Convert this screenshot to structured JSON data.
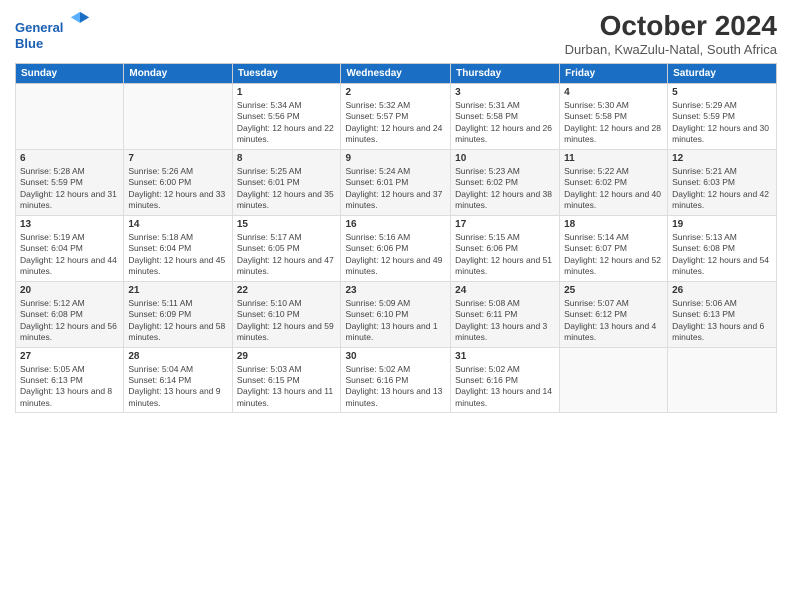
{
  "header": {
    "logo_line1": "General",
    "logo_line2": "Blue",
    "month": "October 2024",
    "location": "Durban, KwaZulu-Natal, South Africa"
  },
  "days_of_week": [
    "Sunday",
    "Monday",
    "Tuesday",
    "Wednesday",
    "Thursday",
    "Friday",
    "Saturday"
  ],
  "weeks": [
    [
      {
        "day": "",
        "info": ""
      },
      {
        "day": "",
        "info": ""
      },
      {
        "day": "1",
        "info": "Sunrise: 5:34 AM\nSunset: 5:56 PM\nDaylight: 12 hours and 22 minutes."
      },
      {
        "day": "2",
        "info": "Sunrise: 5:32 AM\nSunset: 5:57 PM\nDaylight: 12 hours and 24 minutes."
      },
      {
        "day": "3",
        "info": "Sunrise: 5:31 AM\nSunset: 5:58 PM\nDaylight: 12 hours and 26 minutes."
      },
      {
        "day": "4",
        "info": "Sunrise: 5:30 AM\nSunset: 5:58 PM\nDaylight: 12 hours and 28 minutes."
      },
      {
        "day": "5",
        "info": "Sunrise: 5:29 AM\nSunset: 5:59 PM\nDaylight: 12 hours and 30 minutes."
      }
    ],
    [
      {
        "day": "6",
        "info": "Sunrise: 5:28 AM\nSunset: 5:59 PM\nDaylight: 12 hours and 31 minutes."
      },
      {
        "day": "7",
        "info": "Sunrise: 5:26 AM\nSunset: 6:00 PM\nDaylight: 12 hours and 33 minutes."
      },
      {
        "day": "8",
        "info": "Sunrise: 5:25 AM\nSunset: 6:01 PM\nDaylight: 12 hours and 35 minutes."
      },
      {
        "day": "9",
        "info": "Sunrise: 5:24 AM\nSunset: 6:01 PM\nDaylight: 12 hours and 37 minutes."
      },
      {
        "day": "10",
        "info": "Sunrise: 5:23 AM\nSunset: 6:02 PM\nDaylight: 12 hours and 38 minutes."
      },
      {
        "day": "11",
        "info": "Sunrise: 5:22 AM\nSunset: 6:02 PM\nDaylight: 12 hours and 40 minutes."
      },
      {
        "day": "12",
        "info": "Sunrise: 5:21 AM\nSunset: 6:03 PM\nDaylight: 12 hours and 42 minutes."
      }
    ],
    [
      {
        "day": "13",
        "info": "Sunrise: 5:19 AM\nSunset: 6:04 PM\nDaylight: 12 hours and 44 minutes."
      },
      {
        "day": "14",
        "info": "Sunrise: 5:18 AM\nSunset: 6:04 PM\nDaylight: 12 hours and 45 minutes."
      },
      {
        "day": "15",
        "info": "Sunrise: 5:17 AM\nSunset: 6:05 PM\nDaylight: 12 hours and 47 minutes."
      },
      {
        "day": "16",
        "info": "Sunrise: 5:16 AM\nSunset: 6:06 PM\nDaylight: 12 hours and 49 minutes."
      },
      {
        "day": "17",
        "info": "Sunrise: 5:15 AM\nSunset: 6:06 PM\nDaylight: 12 hours and 51 minutes."
      },
      {
        "day": "18",
        "info": "Sunrise: 5:14 AM\nSunset: 6:07 PM\nDaylight: 12 hours and 52 minutes."
      },
      {
        "day": "19",
        "info": "Sunrise: 5:13 AM\nSunset: 6:08 PM\nDaylight: 12 hours and 54 minutes."
      }
    ],
    [
      {
        "day": "20",
        "info": "Sunrise: 5:12 AM\nSunset: 6:08 PM\nDaylight: 12 hours and 56 minutes."
      },
      {
        "day": "21",
        "info": "Sunrise: 5:11 AM\nSunset: 6:09 PM\nDaylight: 12 hours and 58 minutes."
      },
      {
        "day": "22",
        "info": "Sunrise: 5:10 AM\nSunset: 6:10 PM\nDaylight: 12 hours and 59 minutes."
      },
      {
        "day": "23",
        "info": "Sunrise: 5:09 AM\nSunset: 6:10 PM\nDaylight: 13 hours and 1 minute."
      },
      {
        "day": "24",
        "info": "Sunrise: 5:08 AM\nSunset: 6:11 PM\nDaylight: 13 hours and 3 minutes."
      },
      {
        "day": "25",
        "info": "Sunrise: 5:07 AM\nSunset: 6:12 PM\nDaylight: 13 hours and 4 minutes."
      },
      {
        "day": "26",
        "info": "Sunrise: 5:06 AM\nSunset: 6:13 PM\nDaylight: 13 hours and 6 minutes."
      }
    ],
    [
      {
        "day": "27",
        "info": "Sunrise: 5:05 AM\nSunset: 6:13 PM\nDaylight: 13 hours and 8 minutes."
      },
      {
        "day": "28",
        "info": "Sunrise: 5:04 AM\nSunset: 6:14 PM\nDaylight: 13 hours and 9 minutes."
      },
      {
        "day": "29",
        "info": "Sunrise: 5:03 AM\nSunset: 6:15 PM\nDaylight: 13 hours and 11 minutes."
      },
      {
        "day": "30",
        "info": "Sunrise: 5:02 AM\nSunset: 6:16 PM\nDaylight: 13 hours and 13 minutes."
      },
      {
        "day": "31",
        "info": "Sunrise: 5:02 AM\nSunset: 6:16 PM\nDaylight: 13 hours and 14 minutes."
      },
      {
        "day": "",
        "info": ""
      },
      {
        "day": "",
        "info": ""
      }
    ]
  ]
}
